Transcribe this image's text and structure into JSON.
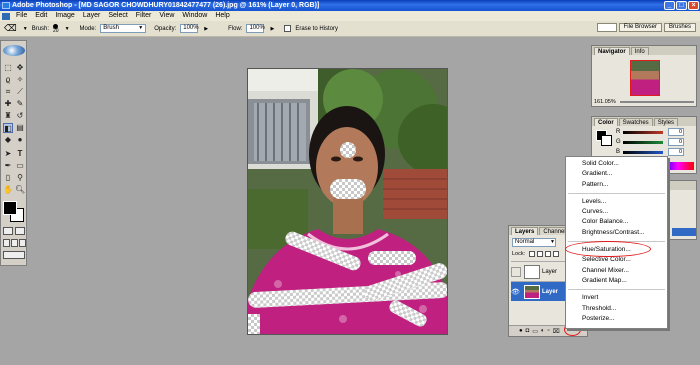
{
  "window": {
    "title": "Adobe Photoshop - [MD SAGOR CHOWDHURY01842477477 (26).jpg @ 161% (Layer 0, RGB)]"
  },
  "menu": [
    "File",
    "Edit",
    "Image",
    "Layer",
    "Select",
    "Filter",
    "View",
    "Window",
    "Help"
  ],
  "options": {
    "brush_label": "Brush:",
    "brush_size": "20",
    "mode_label": "Mode:",
    "mode_value": "Brush",
    "opacity_label": "Opacity:",
    "opacity_value": "100%",
    "flow_label": "Flow:",
    "flow_value": "100%",
    "erase_history_label": "Erase to History"
  },
  "palette_well": {
    "file_browser": "File Browser",
    "brushes": "Brushes"
  },
  "navigator": {
    "tabs": [
      "Navigator",
      "Info"
    ],
    "zoom": "161.05%"
  },
  "color": {
    "tabs": [
      "Color",
      "Swatches",
      "Styles"
    ],
    "channels": [
      {
        "label": "R",
        "value": "0"
      },
      {
        "label": "G",
        "value": "0"
      },
      {
        "label": "B",
        "value": "0"
      }
    ],
    "colors": {
      "r": "#c0392b",
      "g": "#1e8a3a",
      "b": "#2456c8"
    }
  },
  "layers": {
    "tabs": [
      "Layers",
      "Channels"
    ],
    "blend_mode": "Normal",
    "lock_label": "Lock:",
    "layer_names": [
      "Layer",
      "Layer"
    ]
  },
  "context_menu": {
    "items": [
      "Solid Color...",
      "Gradient...",
      "Pattern...",
      "---",
      "Levels...",
      "Curves...",
      "Color Balance...",
      "Brightness/Contrast...",
      "---",
      "Hue/Saturation...",
      "Selective Color...",
      "Channel Mixer...",
      "Gradient Map...",
      "---",
      "Invert",
      "Threshold...",
      "Posterize..."
    ],
    "highlighted": "Hue/Saturation..."
  }
}
